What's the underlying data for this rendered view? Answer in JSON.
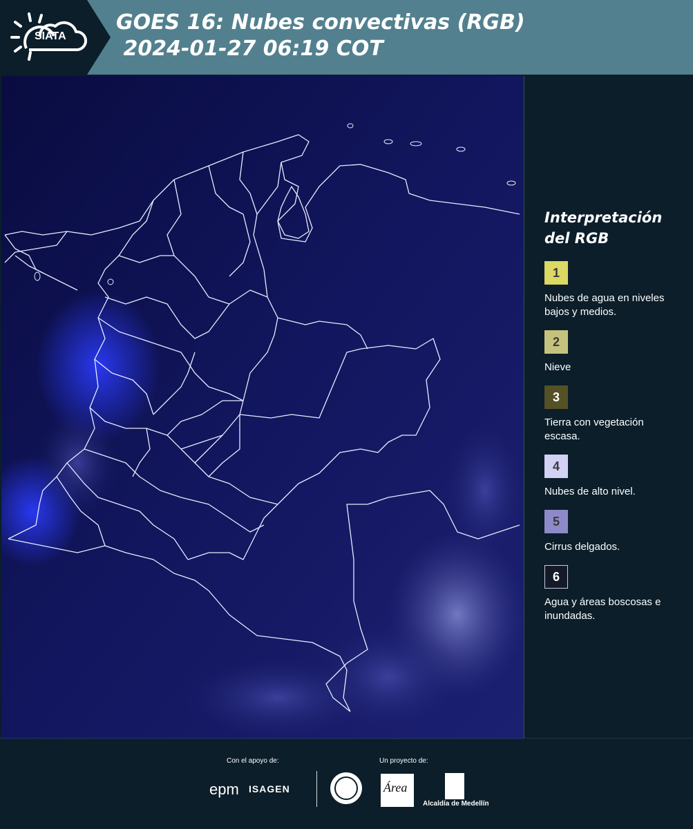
{
  "header": {
    "logo_text": "SIATA",
    "title": "GOES 16: Nubes convectivas (RGB)\n 2024-01-27 06:19 COT"
  },
  "legend": {
    "title": "Interpretación del RGB",
    "items": [
      {
        "number": "1",
        "label": "Nubes de agua en niveles bajos y medios.",
        "color": "#dbd863"
      },
      {
        "number": "2",
        "label": "Nieve",
        "color": "#c5c27d"
      },
      {
        "number": "3",
        "label": "Tierra con vegetación escasa.",
        "color": "#545126"
      },
      {
        "number": "4",
        "label": "Nubes de alto nivel.",
        "color": "#d2d1f3"
      },
      {
        "number": "5",
        "label": "Cirrus delgados.",
        "color": "#8e8ac9"
      },
      {
        "number": "6",
        "label": "Agua y áreas boscosas e inundadas.",
        "color": "#151a2a"
      }
    ]
  },
  "footer": {
    "support_label": "Con el apoyo de:",
    "project_label": "Un proyecto de:",
    "sponsors": [
      "epm",
      "ISAGEN"
    ],
    "partners": [
      "Área Metropolitana Valle de Aburrá",
      "Alcaldía de Medellín"
    ]
  },
  "colors": {
    "header_bg": "#52808f",
    "page_bg": "#0b1e2a",
    "map_bg": "#0a0d4a"
  }
}
